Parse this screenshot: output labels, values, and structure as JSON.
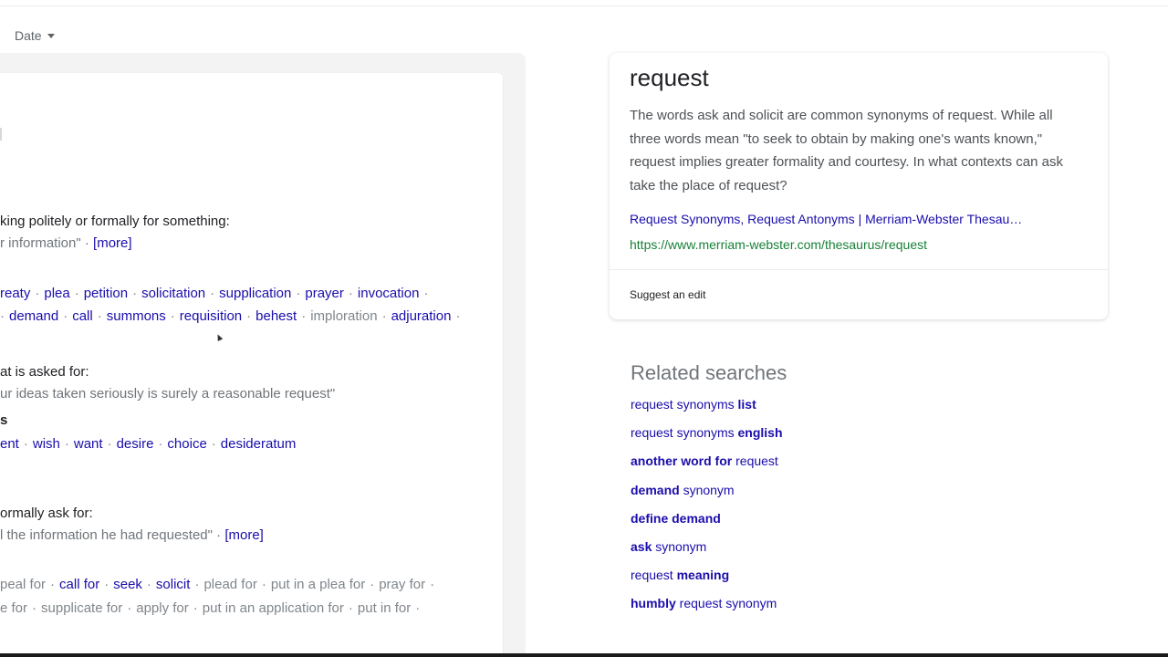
{
  "toolbar": {
    "date_label": "Date"
  },
  "dictionary": {
    "def1": "king politely or formally for something:",
    "ex1": "r information\"",
    "ex1_sep": " · ",
    "more1": "[more]",
    "syn_row1": [
      {
        "t": "reaty",
        "link": true
      },
      {
        "t": "plea",
        "link": true
      },
      {
        "t": "petition",
        "link": true
      },
      {
        "t": "solicitation",
        "link": true
      },
      {
        "t": "supplication",
        "link": true
      },
      {
        "t": "prayer",
        "link": true
      },
      {
        "t": "invocation",
        "link": true
      }
    ],
    "syn_row2": [
      {
        "t": "demand",
        "link": true
      },
      {
        "t": "call",
        "link": true
      },
      {
        "t": "summons",
        "link": true
      },
      {
        "t": "requisition",
        "link": true
      },
      {
        "t": "behest",
        "link": true
      },
      {
        "t": "imploration",
        "link": false
      },
      {
        "t": "adjuration",
        "link": true
      }
    ],
    "def2": "at is asked for:",
    "ex2": "ur ideas taken seriously is surely a reasonable request\"",
    "syn_label": "s",
    "syn_row3": [
      {
        "t": "ent",
        "link": true
      },
      {
        "t": "wish",
        "link": true
      },
      {
        "t": "want",
        "link": true
      },
      {
        "t": "desire",
        "link": true
      },
      {
        "t": "choice",
        "link": true
      },
      {
        "t": "desideratum",
        "link": true
      }
    ],
    "def3": "ormally ask for:",
    "ex3": "l the information he had requested\"",
    "ex3_sep": " · ",
    "more3": "[more]",
    "syn_row4": [
      {
        "t": "peal for",
        "link": false
      },
      {
        "t": "call for",
        "link": true
      },
      {
        "t": "seek",
        "link": true
      },
      {
        "t": "solicit",
        "link": true
      },
      {
        "t": "plead for",
        "link": false
      },
      {
        "t": "put in a plea for",
        "link": false
      },
      {
        "t": "pray for",
        "link": false
      }
    ],
    "syn_row5": [
      {
        "t": "e for",
        "link": false
      },
      {
        "t": "supplicate for",
        "link": false
      },
      {
        "t": "apply for",
        "link": false
      },
      {
        "t": "put in an application for",
        "link": false
      },
      {
        "t": "put in for",
        "link": false
      }
    ]
  },
  "snippet": {
    "title": "request",
    "body": "The words ask and solicit are common synonyms of request. While all three words mean \"to seek to obtain by making one's wants known,\" request implies greater formality and courtesy. In what contexts can ask take the place of request?",
    "link_title": "Request Synonyms, Request Antonyms | Merriam-Webster Thesau…",
    "url": "https://www.merriam-webster.com/thesaurus/request",
    "suggest_edit": "Suggest an edit"
  },
  "related": {
    "title": "Related searches",
    "items": [
      {
        "parts": [
          {
            "t": "request synonyms ",
            "b": false
          },
          {
            "t": "list",
            "b": true
          }
        ]
      },
      {
        "parts": [
          {
            "t": "request synonyms ",
            "b": false
          },
          {
            "t": "english",
            "b": true
          }
        ]
      },
      {
        "parts": [
          {
            "t": "another word for ",
            "b": true
          },
          {
            "t": "request",
            "b": false
          }
        ]
      },
      {
        "parts": [
          {
            "t": "demand ",
            "b": true
          },
          {
            "t": "synonym",
            "b": false
          }
        ]
      },
      {
        "parts": [
          {
            "t": "define demand",
            "b": true
          }
        ]
      },
      {
        "parts": [
          {
            "t": "ask ",
            "b": true
          },
          {
            "t": "synonym",
            "b": false
          }
        ]
      },
      {
        "parts": [
          {
            "t": "request ",
            "b": false
          },
          {
            "t": "meaning",
            "b": true
          }
        ]
      },
      {
        "parts": [
          {
            "t": "humbly ",
            "b": true
          },
          {
            "t": "request synonym",
            "b": false
          }
        ]
      }
    ]
  }
}
